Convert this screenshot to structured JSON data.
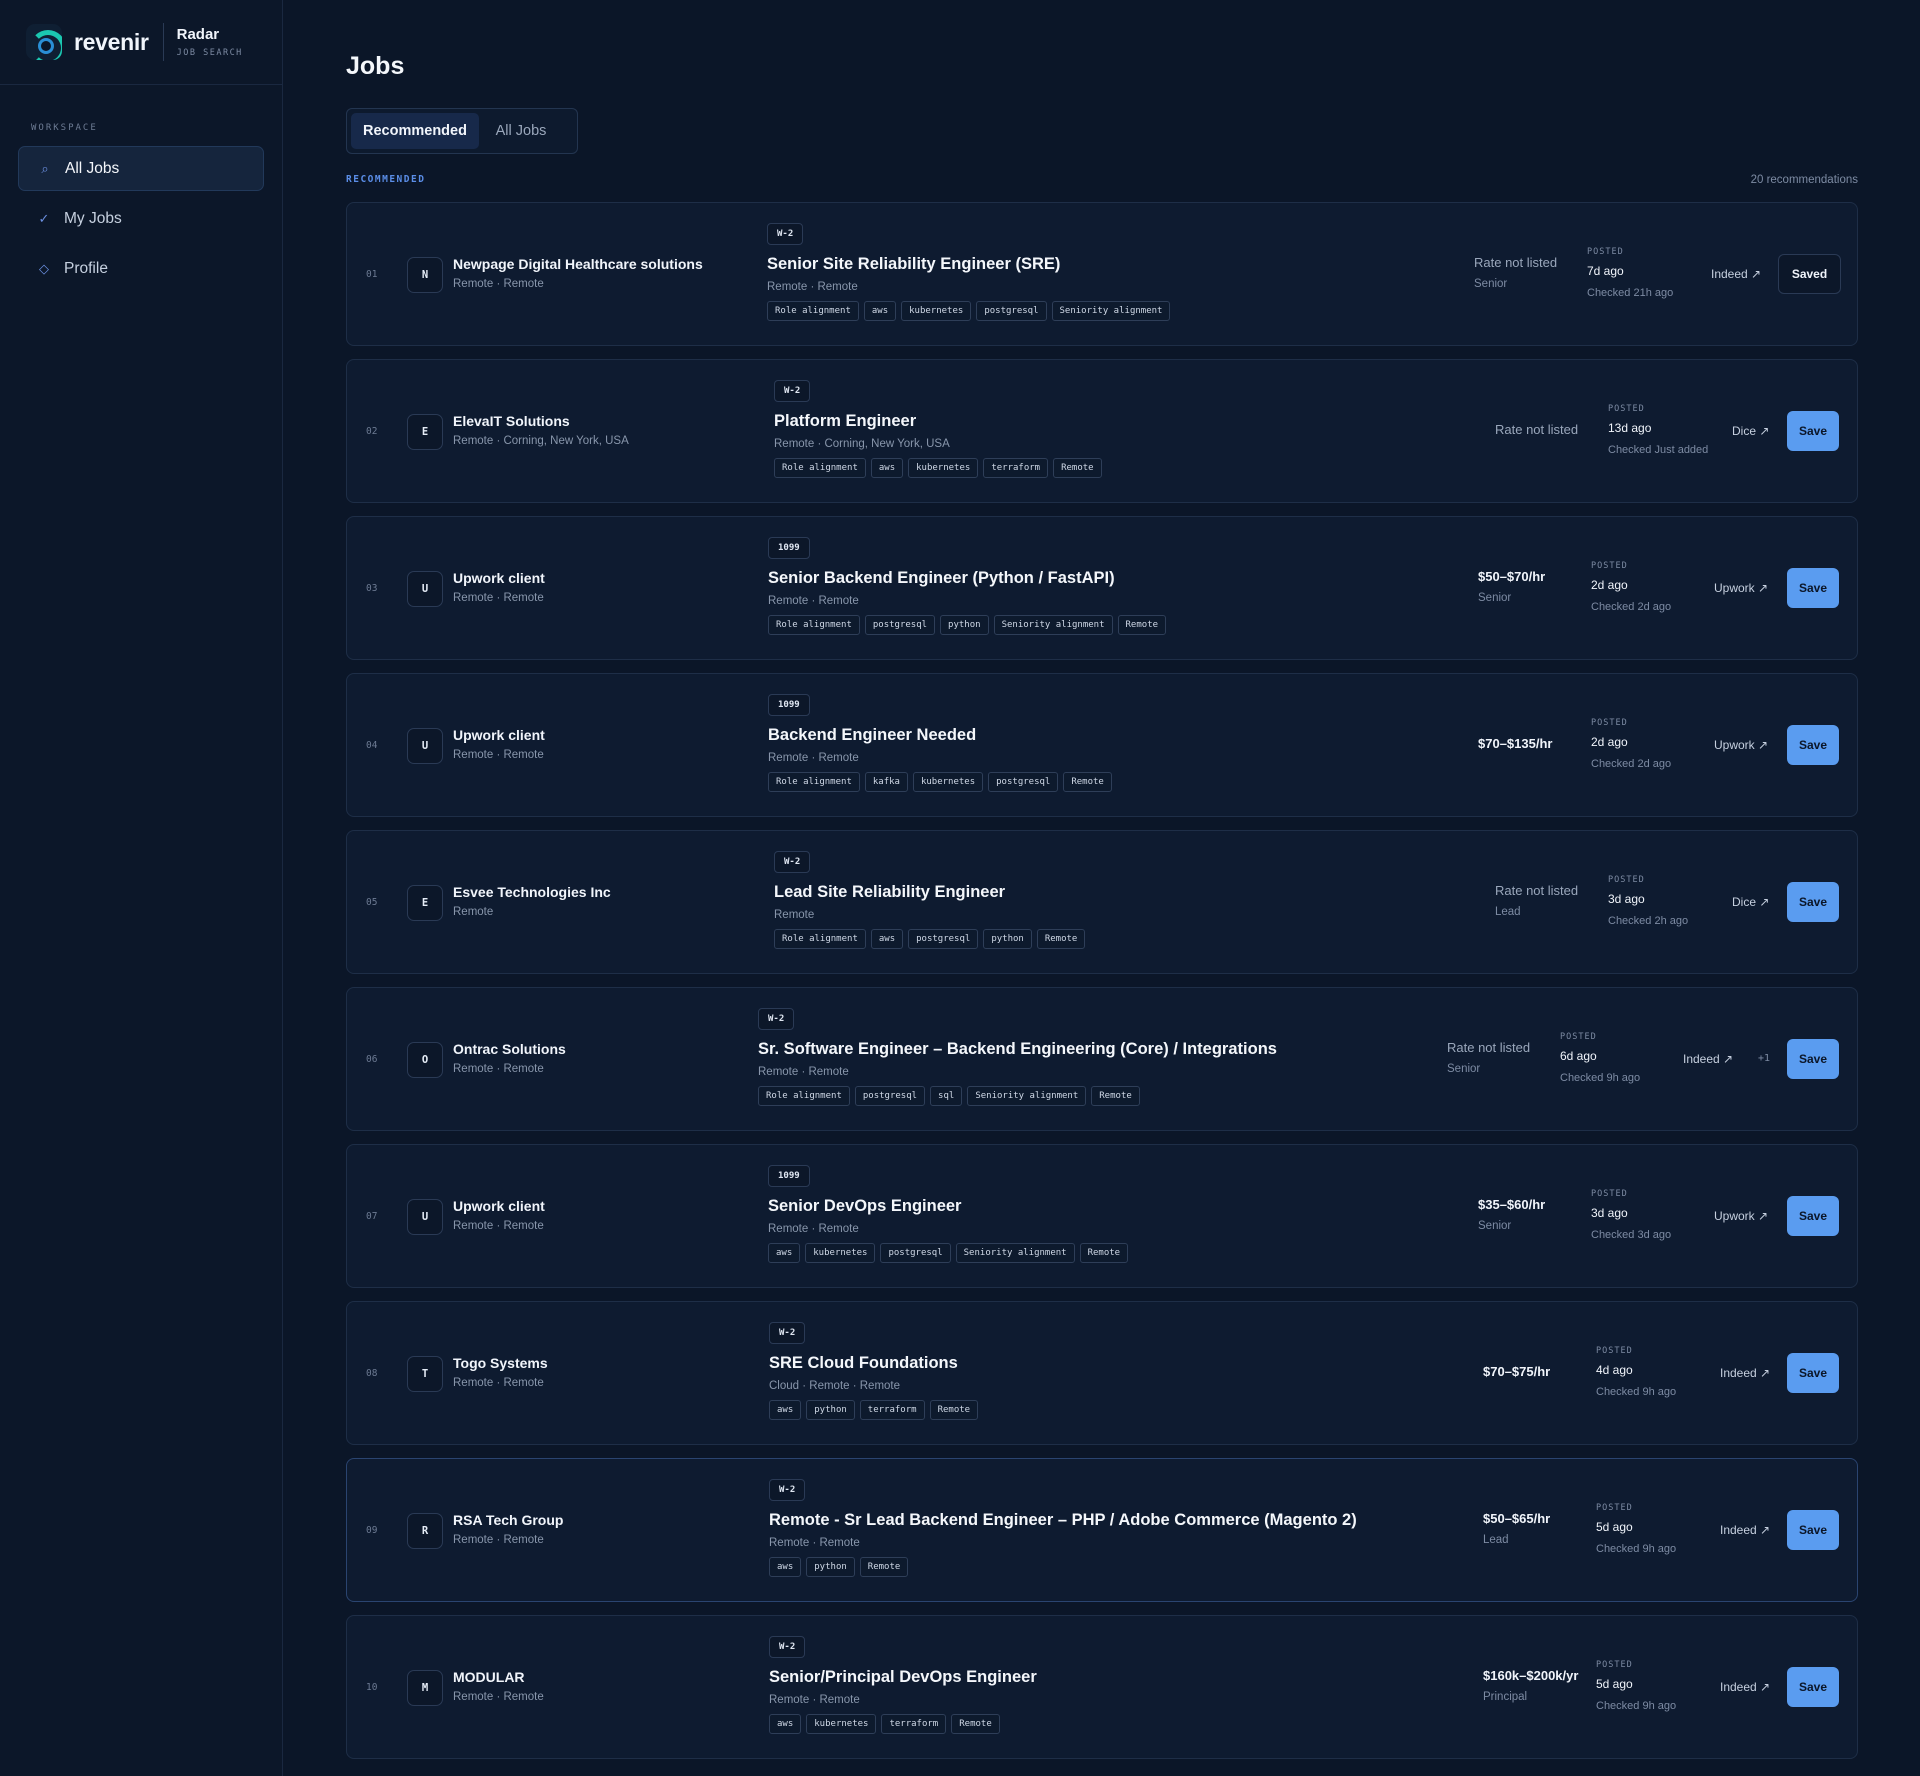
{
  "brand": {
    "name": "revenir",
    "product": "Radar",
    "subtitle": "JOB SEARCH"
  },
  "sidebar": {
    "section_label": "WORKSPACE",
    "items": [
      {
        "label": "All Jobs",
        "icon": "search-icon"
      },
      {
        "label": "My Jobs",
        "icon": "check-icon"
      },
      {
        "label": "Profile",
        "icon": "diamond-icon"
      }
    ]
  },
  "main": {
    "title": "Jobs",
    "tabs": [
      {
        "label": "Recommended"
      },
      {
        "label": "All Jobs"
      }
    ],
    "section_label": "RECOMMENDED",
    "count": "20 recommendations"
  },
  "jobs": [
    {
      "num": "01",
      "initial": "N",
      "company": "Newpage Digital Healthcare solutions",
      "company_loc": "Remote · Remote",
      "type": "W-2",
      "title": "Senior Site Reliability Engineer (SRE)",
      "location": "Remote · Remote",
      "tags": [
        "Role alignment",
        "aws",
        "kubernetes",
        "postgresql",
        "Seniority alignment"
      ],
      "rate": "Rate not listed",
      "level": "Senior",
      "posted_label": "POSTED",
      "posted": "7d ago",
      "checked": "Checked 21h ago",
      "source": "Indeed ↗",
      "extra": "",
      "action": "Saved"
    },
    {
      "num": "02",
      "initial": "E",
      "company": "ElevaIT Solutions",
      "company_loc": "Remote · Corning, New York, USA",
      "type": "W-2",
      "title": "Platform Engineer",
      "location": "Remote · Corning, New York, USA",
      "tags": [
        "Role alignment",
        "aws",
        "kubernetes",
        "terraform",
        "Remote"
      ],
      "rate": "Rate not listed",
      "level": "",
      "posted_label": "POSTED",
      "posted": "13d ago",
      "checked": "Checked Just added",
      "source": "Dice ↗",
      "extra": "",
      "action": "Save"
    },
    {
      "num": "03",
      "initial": "U",
      "company": "Upwork client",
      "company_loc": "Remote · Remote",
      "type": "1099",
      "title": "Senior Backend Engineer (Python / FastAPI)",
      "location": "Remote · Remote",
      "tags": [
        "Role alignment",
        "postgresql",
        "python",
        "Seniority alignment",
        "Remote"
      ],
      "rate": "$50–$70/hr",
      "level": "Senior",
      "posted_label": "POSTED",
      "posted": "2d ago",
      "checked": "Checked 2d ago",
      "source": "Upwork ↗",
      "extra": "",
      "action": "Save"
    },
    {
      "num": "04",
      "initial": "U",
      "company": "Upwork client",
      "company_loc": "Remote · Remote",
      "type": "1099",
      "title": "Backend Engineer Needed",
      "location": "Remote · Remote",
      "tags": [
        "Role alignment",
        "kafka",
        "kubernetes",
        "postgresql",
        "Remote"
      ],
      "rate": "$70–$135/hr",
      "level": "",
      "posted_label": "POSTED",
      "posted": "2d ago",
      "checked": "Checked 2d ago",
      "source": "Upwork ↗",
      "extra": "",
      "action": "Save"
    },
    {
      "num": "05",
      "initial": "E",
      "company": "Esvee Technologies Inc",
      "company_loc": "Remote",
      "type": "W-2",
      "title": "Lead Site Reliability Engineer",
      "location": "Remote",
      "tags": [
        "Role alignment",
        "aws",
        "postgresql",
        "python",
        "Remote"
      ],
      "rate": "Rate not listed",
      "level": "Lead",
      "posted_label": "POSTED",
      "posted": "3d ago",
      "checked": "Checked 2h ago",
      "source": "Dice ↗",
      "extra": "",
      "action": "Save"
    },
    {
      "num": "06",
      "initial": "O",
      "company": "Ontrac Solutions",
      "company_loc": "Remote · Remote",
      "type": "W-2",
      "title": "Sr. Software Engineer – Backend Engineering (Core) / Integrations",
      "location": "Remote · Remote",
      "tags": [
        "Role alignment",
        "postgresql",
        "sql",
        "Seniority alignment",
        "Remote"
      ],
      "rate": "Rate not listed",
      "level": "Senior",
      "posted_label": "POSTED",
      "posted": "6d ago",
      "checked": "Checked 9h ago",
      "source": "Indeed ↗",
      "extra": "+1",
      "action": "Save"
    },
    {
      "num": "07",
      "initial": "U",
      "company": "Upwork client",
      "company_loc": "Remote · Remote",
      "type": "1099",
      "title": "Senior DevOps Engineer",
      "location": "Remote · Remote",
      "tags": [
        "aws",
        "kubernetes",
        "postgresql",
        "Seniority alignment",
        "Remote"
      ],
      "rate": "$35–$60/hr",
      "level": "Senior",
      "posted_label": "POSTED",
      "posted": "3d ago",
      "checked": "Checked 3d ago",
      "source": "Upwork ↗",
      "extra": "",
      "action": "Save"
    },
    {
      "num": "08",
      "initial": "T",
      "company": "Togo Systems",
      "company_loc": "Remote · Remote",
      "type": "W-2",
      "title": "SRE Cloud Foundations",
      "location": "Cloud · Remote · Remote",
      "tags": [
        "aws",
        "python",
        "terraform",
        "Remote"
      ],
      "rate": "$70–$75/hr",
      "level": "",
      "posted_label": "POSTED",
      "posted": "4d ago",
      "checked": "Checked 9h ago",
      "source": "Indeed ↗",
      "extra": "",
      "action": "Save"
    },
    {
      "num": "09",
      "initial": "R",
      "company": "RSA Tech Group",
      "company_loc": "Remote · Remote",
      "type": "W-2",
      "title": "Remote - Sr Lead Backend Engineer – PHP / Adobe Commerce (Magento 2)",
      "location": "Remote · Remote",
      "tags": [
        "aws",
        "python",
        "Remote"
      ],
      "rate": "$50–$65/hr",
      "level": "Lead",
      "posted_label": "POSTED",
      "posted": "5d ago",
      "checked": "Checked 9h ago",
      "source": "Indeed ↗",
      "extra": "",
      "action": "Save"
    },
    {
      "num": "10",
      "initial": "M",
      "company": "MODULAR",
      "company_loc": "Remote · Remote",
      "type": "W-2",
      "title": "Senior/Principal DevOps Engineer",
      "location": "Remote · Remote",
      "tags": [
        "aws",
        "kubernetes",
        "terraform",
        "Remote"
      ],
      "rate": "$160k–$200k/yr",
      "level": "Principal",
      "posted_label": "POSTED",
      "posted": "5d ago",
      "checked": "Checked 9h ago",
      "source": "Indeed ↗",
      "extra": "",
      "action": "Save"
    }
  ]
}
